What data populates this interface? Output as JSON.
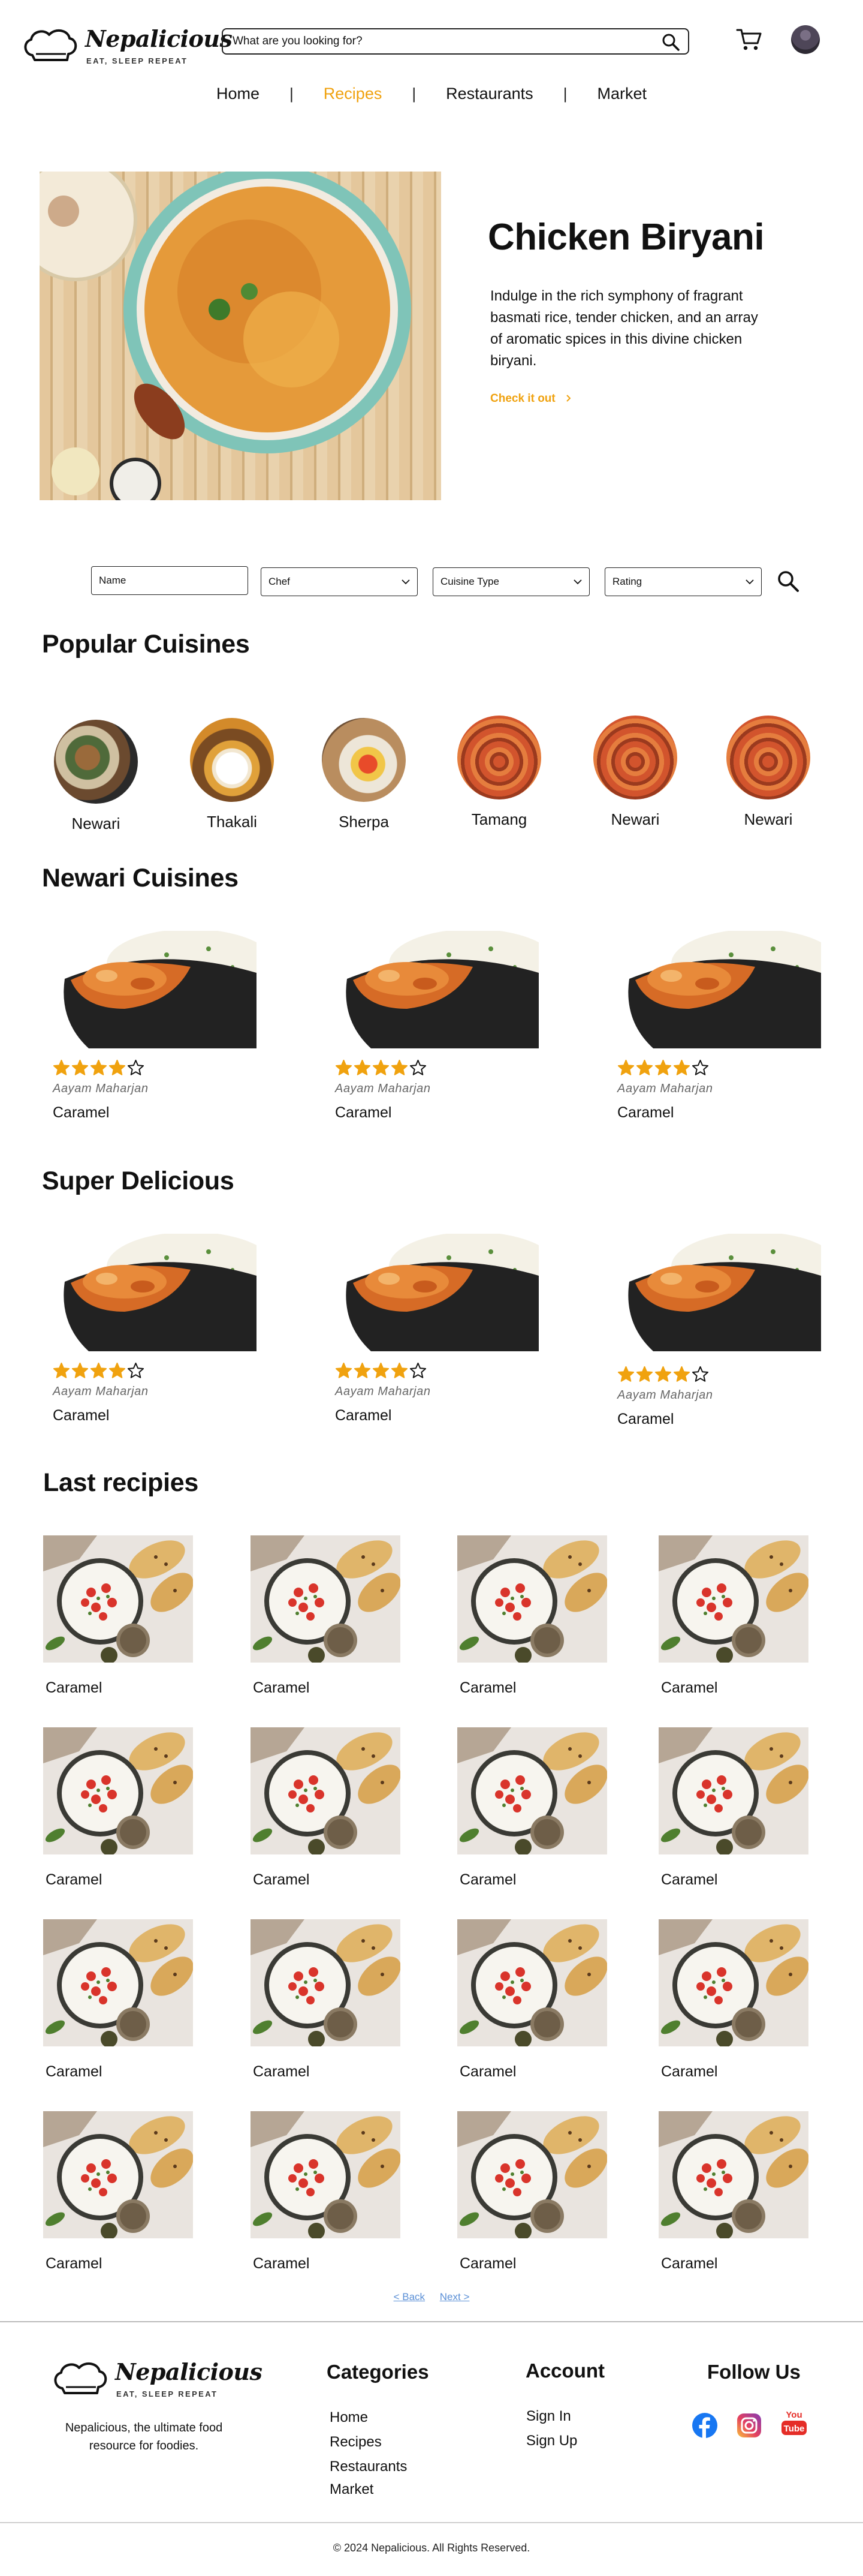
{
  "brand": {
    "name": "Nepalicious",
    "tagline": "EAT, SLEEP REPEAT"
  },
  "search": {
    "placeholder": "What are you looking for?"
  },
  "icons": {
    "search": "search-icon",
    "cart": "cart-icon",
    "avatar": "user-avatar"
  },
  "nav": {
    "items": [
      {
        "label": "Home",
        "active": false
      },
      {
        "label": "Recipes",
        "active": true
      },
      {
        "label": "Restaurants",
        "active": false
      },
      {
        "label": "Market",
        "active": false
      }
    ],
    "separator": "|"
  },
  "hero": {
    "title": "Chicken Biryani",
    "description": "Indulge in the rich symphony of fragrant basmati rice, tender chicken, and an array of aromatic spices in this divine chicken biryani.",
    "cta": "Check it out"
  },
  "filters": {
    "name_placeholder": "Name",
    "chef": "Chef",
    "cuisine": "Cuisine Type",
    "rating": "Rating"
  },
  "popular": {
    "title": "Popular Cuisines",
    "items": [
      {
        "label": "Newari"
      },
      {
        "label": "Thakali"
      },
      {
        "label": "Sherpa"
      },
      {
        "label": "Tamang"
      },
      {
        "label": "Newari"
      },
      {
        "label": "Newari"
      }
    ]
  },
  "newari_section": {
    "title": "Newari Cuisines",
    "cards": [
      {
        "rating": 4,
        "max": 5,
        "chef": "Aayam Maharjan",
        "title": "Caramel"
      },
      {
        "rating": 4,
        "max": 5,
        "chef": "Aayam Maharjan",
        "title": "Caramel"
      },
      {
        "rating": 4,
        "max": 5,
        "chef": "Aayam Maharjan",
        "title": "Caramel"
      }
    ]
  },
  "delicious_section": {
    "title": "Super Delicious",
    "cards": [
      {
        "rating": 4,
        "max": 5,
        "chef": "Aayam Maharjan",
        "title": "Caramel"
      },
      {
        "rating": 4,
        "max": 5,
        "chef": "Aayam Maharjan",
        "title": "Caramel"
      },
      {
        "rating": 4,
        "max": 5,
        "chef": "Aayam Maharjan",
        "title": "Caramel"
      }
    ]
  },
  "last_section": {
    "title": "Last recipies",
    "items": [
      "Caramel",
      "Caramel",
      "Caramel",
      "Caramel",
      "Caramel",
      "Caramel",
      "Caramel",
      "Caramel",
      "Caramel",
      "Caramel",
      "Caramel",
      "Caramel",
      "Caramel",
      "Caramel",
      "Caramel",
      "Caramel"
    ]
  },
  "pagination": {
    "back": "< Back",
    "next": "Next >"
  },
  "footer": {
    "description": "Nepalicious, the ultimate food resource for foodies.",
    "categories": {
      "title": "Categories",
      "links": [
        "Home",
        "Recipes",
        "Restaurants",
        "Market"
      ]
    },
    "account": {
      "title": "Account",
      "links": [
        "Sign In",
        "Sign Up"
      ]
    },
    "follow": {
      "title": "Follow Us",
      "icons": [
        "facebook-icon",
        "instagram-icon",
        "youtube-icon"
      ]
    },
    "copyright": "© 2024 Nepalicious. All Rights Reserved."
  },
  "colors": {
    "accent": "#f0a20f",
    "star": "#f0a20f",
    "text": "#111111",
    "link": "#5a8fd6"
  }
}
